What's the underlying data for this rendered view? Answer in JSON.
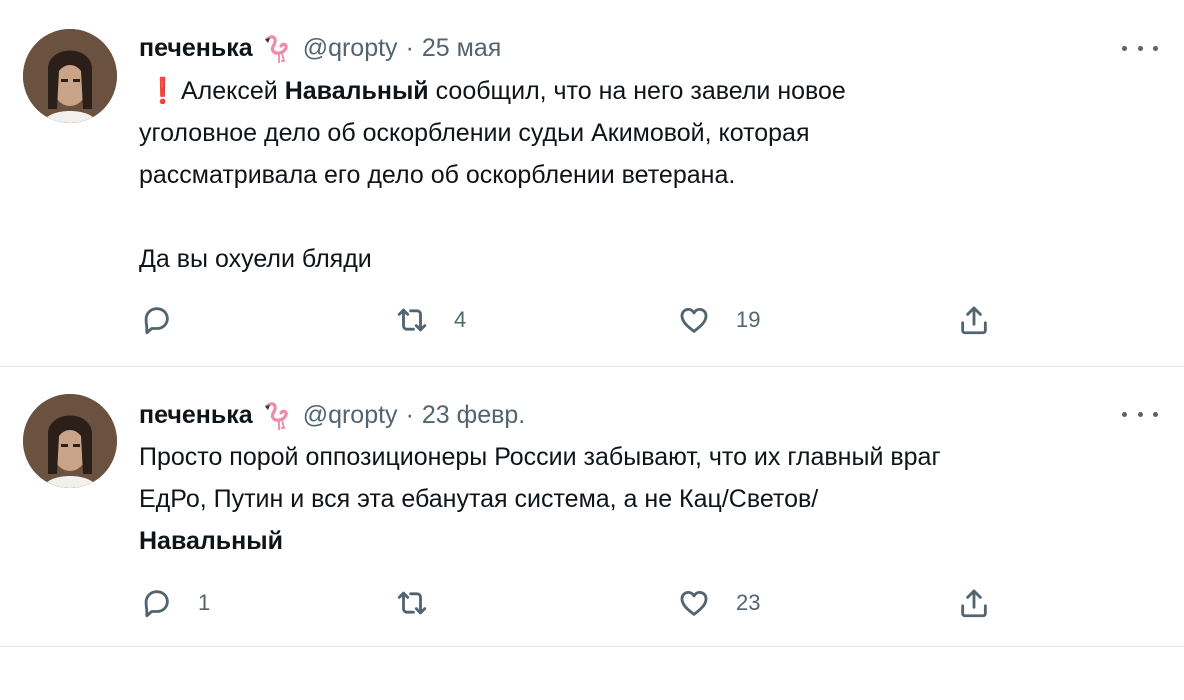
{
  "tweets": [
    {
      "name": "печенька",
      "handle": "@qropty",
      "separator": "·",
      "date": "25 мая",
      "text_lines": [
        [
          "Алексей ",
          "Навальный",
          " сообщил, что на него завели новое"
        ],
        "уголовное дело об оскорблении судьи Акимовой, которая",
        "рассматривала его дело об оскорблении ветерана.",
        "",
        "Да вы охуели бляди"
      ],
      "exclamation": "❗",
      "replies": "",
      "retweets": "4",
      "likes": "19"
    },
    {
      "name": "печенька",
      "handle": "@qropty",
      "separator": "·",
      "date": "23 февр.",
      "text_lines": [
        "Просто порой оппозиционеры России забывают, что их главный враг",
        "ЕдРо, Путин и вся эта ебанутая система, а не Кац/Светов/",
        "Навальный"
      ],
      "replies": "1",
      "retweets": "",
      "likes": "23"
    }
  ],
  "icons": {
    "more": "more-icon",
    "reply": "reply-icon",
    "retweet": "retweet-icon",
    "like": "like-icon",
    "share": "share-icon",
    "emoji": "flamingo-icon"
  },
  "colors": {
    "text": "#0f1419",
    "secondary": "#536471",
    "divider": "#e6ecf0",
    "exclamation": "#e0245e"
  }
}
